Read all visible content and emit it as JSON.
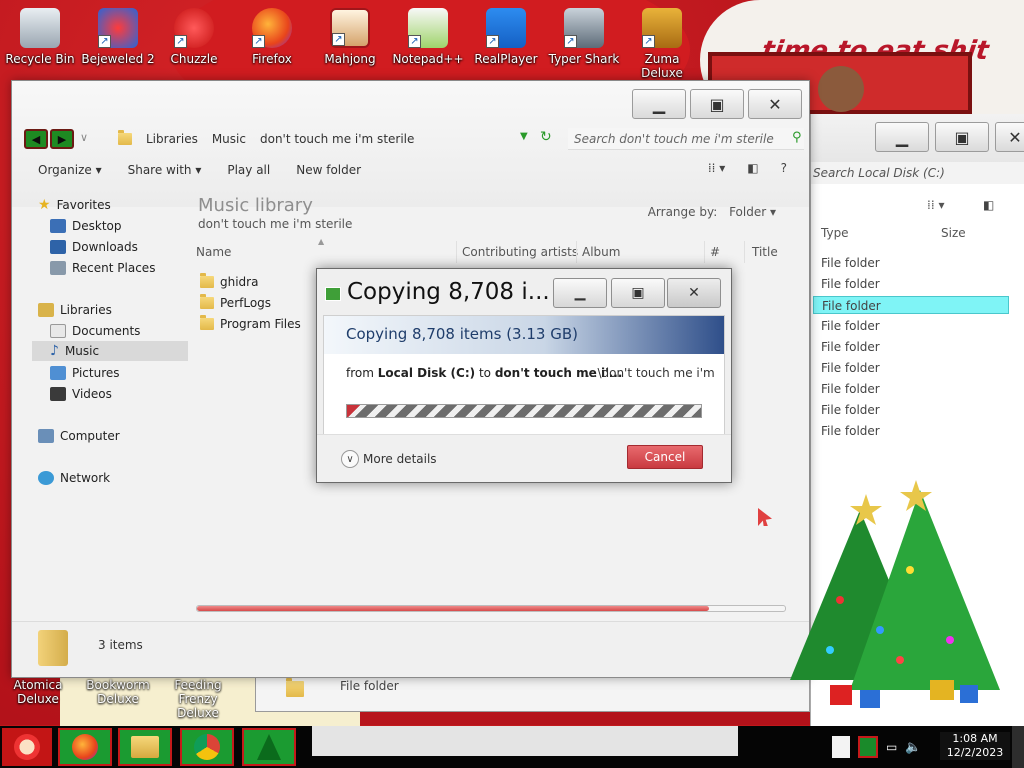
{
  "desktop": {
    "icons": [
      {
        "label": "Recycle Bin"
      },
      {
        "label": "Bejeweled 2"
      },
      {
        "label": "Chuzzle"
      },
      {
        "label": "Firefox"
      },
      {
        "label": "Mahjong"
      },
      {
        "label": "Notepad++"
      },
      {
        "label": "RealPlayer"
      },
      {
        "label": "Typer Shark"
      },
      {
        "label": "Zuma Deluxe"
      }
    ],
    "bottom_icons": [
      {
        "label": "Atomica Deluxe"
      },
      {
        "label": "Bookworm Deluxe"
      },
      {
        "label": "Feeding Frenzy Deluxe"
      }
    ],
    "banner_text": "time to eat shit"
  },
  "explorer": {
    "breadcrumb": [
      "Libraries",
      "Music",
      "don't touch me i'm sterile"
    ],
    "search_placeholder": "Search don't touch me i'm sterile",
    "toolbar": {
      "organize": "Organize",
      "share_with": "Share with",
      "play_all": "Play all",
      "new_folder": "New folder"
    },
    "nav": {
      "favorites": "Favorites",
      "desktop": "Desktop",
      "downloads": "Downloads",
      "recent_places": "Recent Places",
      "libraries": "Libraries",
      "documents": "Documents",
      "music": "Music",
      "pictures": "Pictures",
      "videos": "Videos",
      "computer": "Computer",
      "network": "Network"
    },
    "library_title": "Music library",
    "library_subtitle": "don't touch me i'm sterile",
    "arrange_by_label": "Arrange by:",
    "arrange_by_value": "Folder",
    "columns": {
      "name": "Name",
      "contributing_artists": "Contributing artists",
      "album": "Album",
      "number": "#",
      "title": "Title"
    },
    "files": [
      "ghidra",
      "PerfLogs",
      "Program Files"
    ],
    "progress_fraction": 0.87,
    "items_count": "3 items"
  },
  "explorer2": {
    "search_placeholder": "Search Local Disk (C:)",
    "headers": {
      "type": "Type",
      "size": "Size"
    },
    "rows": [
      "File folder",
      "File folder",
      "File folder",
      "File folder",
      "File folder",
      "File folder",
      "File folder",
      "File folder",
      "File folder"
    ],
    "selected_row_index": 2
  },
  "explorer3": {
    "row_type": "File folder"
  },
  "copy_dialog": {
    "title": "Copying 8,708 i...",
    "banner": "Copying 8,708 items (3.13 GB)",
    "from_prefix": "from",
    "from_source": "Local Disk (C:)",
    "to_word": "to",
    "to_dest": "don't touch me i'...",
    "path": "...\\don't touch me i'm",
    "more_details": "More details",
    "cancel": "Cancel"
  },
  "taskbar": {
    "clock_time": "1:08 AM",
    "clock_date": "12/2/2023"
  },
  "colors": {
    "wallpaper_red": "#c2181b",
    "taskbar_green": "#1b9b31",
    "cancel_red": "#c93a40",
    "selected_cyan": "#7ff4f6"
  }
}
